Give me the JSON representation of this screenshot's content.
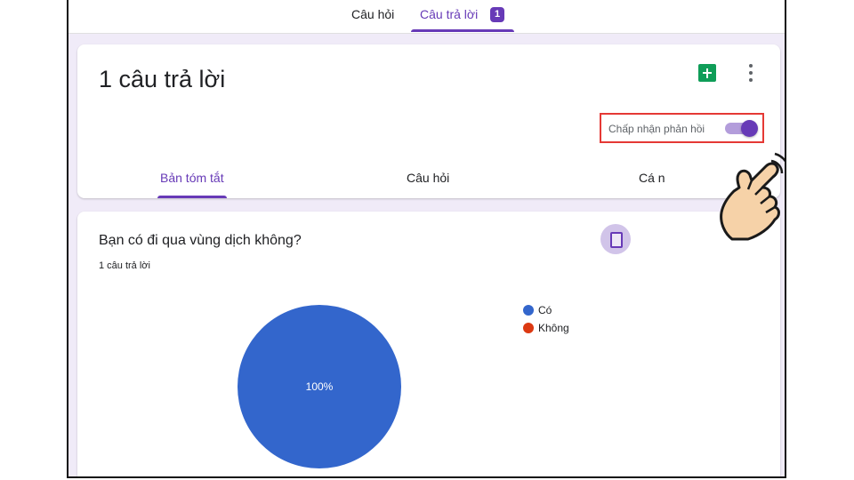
{
  "top_tabs": [
    {
      "label": "Câu hỏi"
    },
    {
      "label": "Câu trả lời",
      "badge": "1",
      "active": true
    }
  ],
  "header": {
    "title": "1 câu trả lời",
    "accepting_label": "Chấp nhận phản hồi",
    "accepting_on": true,
    "icons": [
      "sheets-icon",
      "more-vert-icon"
    ]
  },
  "sub_tabs": [
    {
      "label": "Bản tóm tắt",
      "active": true
    },
    {
      "label": "Câu hỏi"
    },
    {
      "label": "Cá nhân"
    }
  ],
  "question": {
    "title": "Bạn có đi qua vùng dịch không?",
    "response_count": "1 câu trả lời"
  },
  "chart_data": {
    "type": "pie",
    "categories": [
      "Có",
      "Không"
    ],
    "values": [
      100,
      0
    ],
    "slice_label": "100%",
    "colors": [
      "#3366cc",
      "#dc3912"
    ],
    "legend_position": "right"
  },
  "colors": {
    "accent": "#673ab7",
    "highlight_box": "#e53935",
    "background": "#f0ebf8"
  }
}
